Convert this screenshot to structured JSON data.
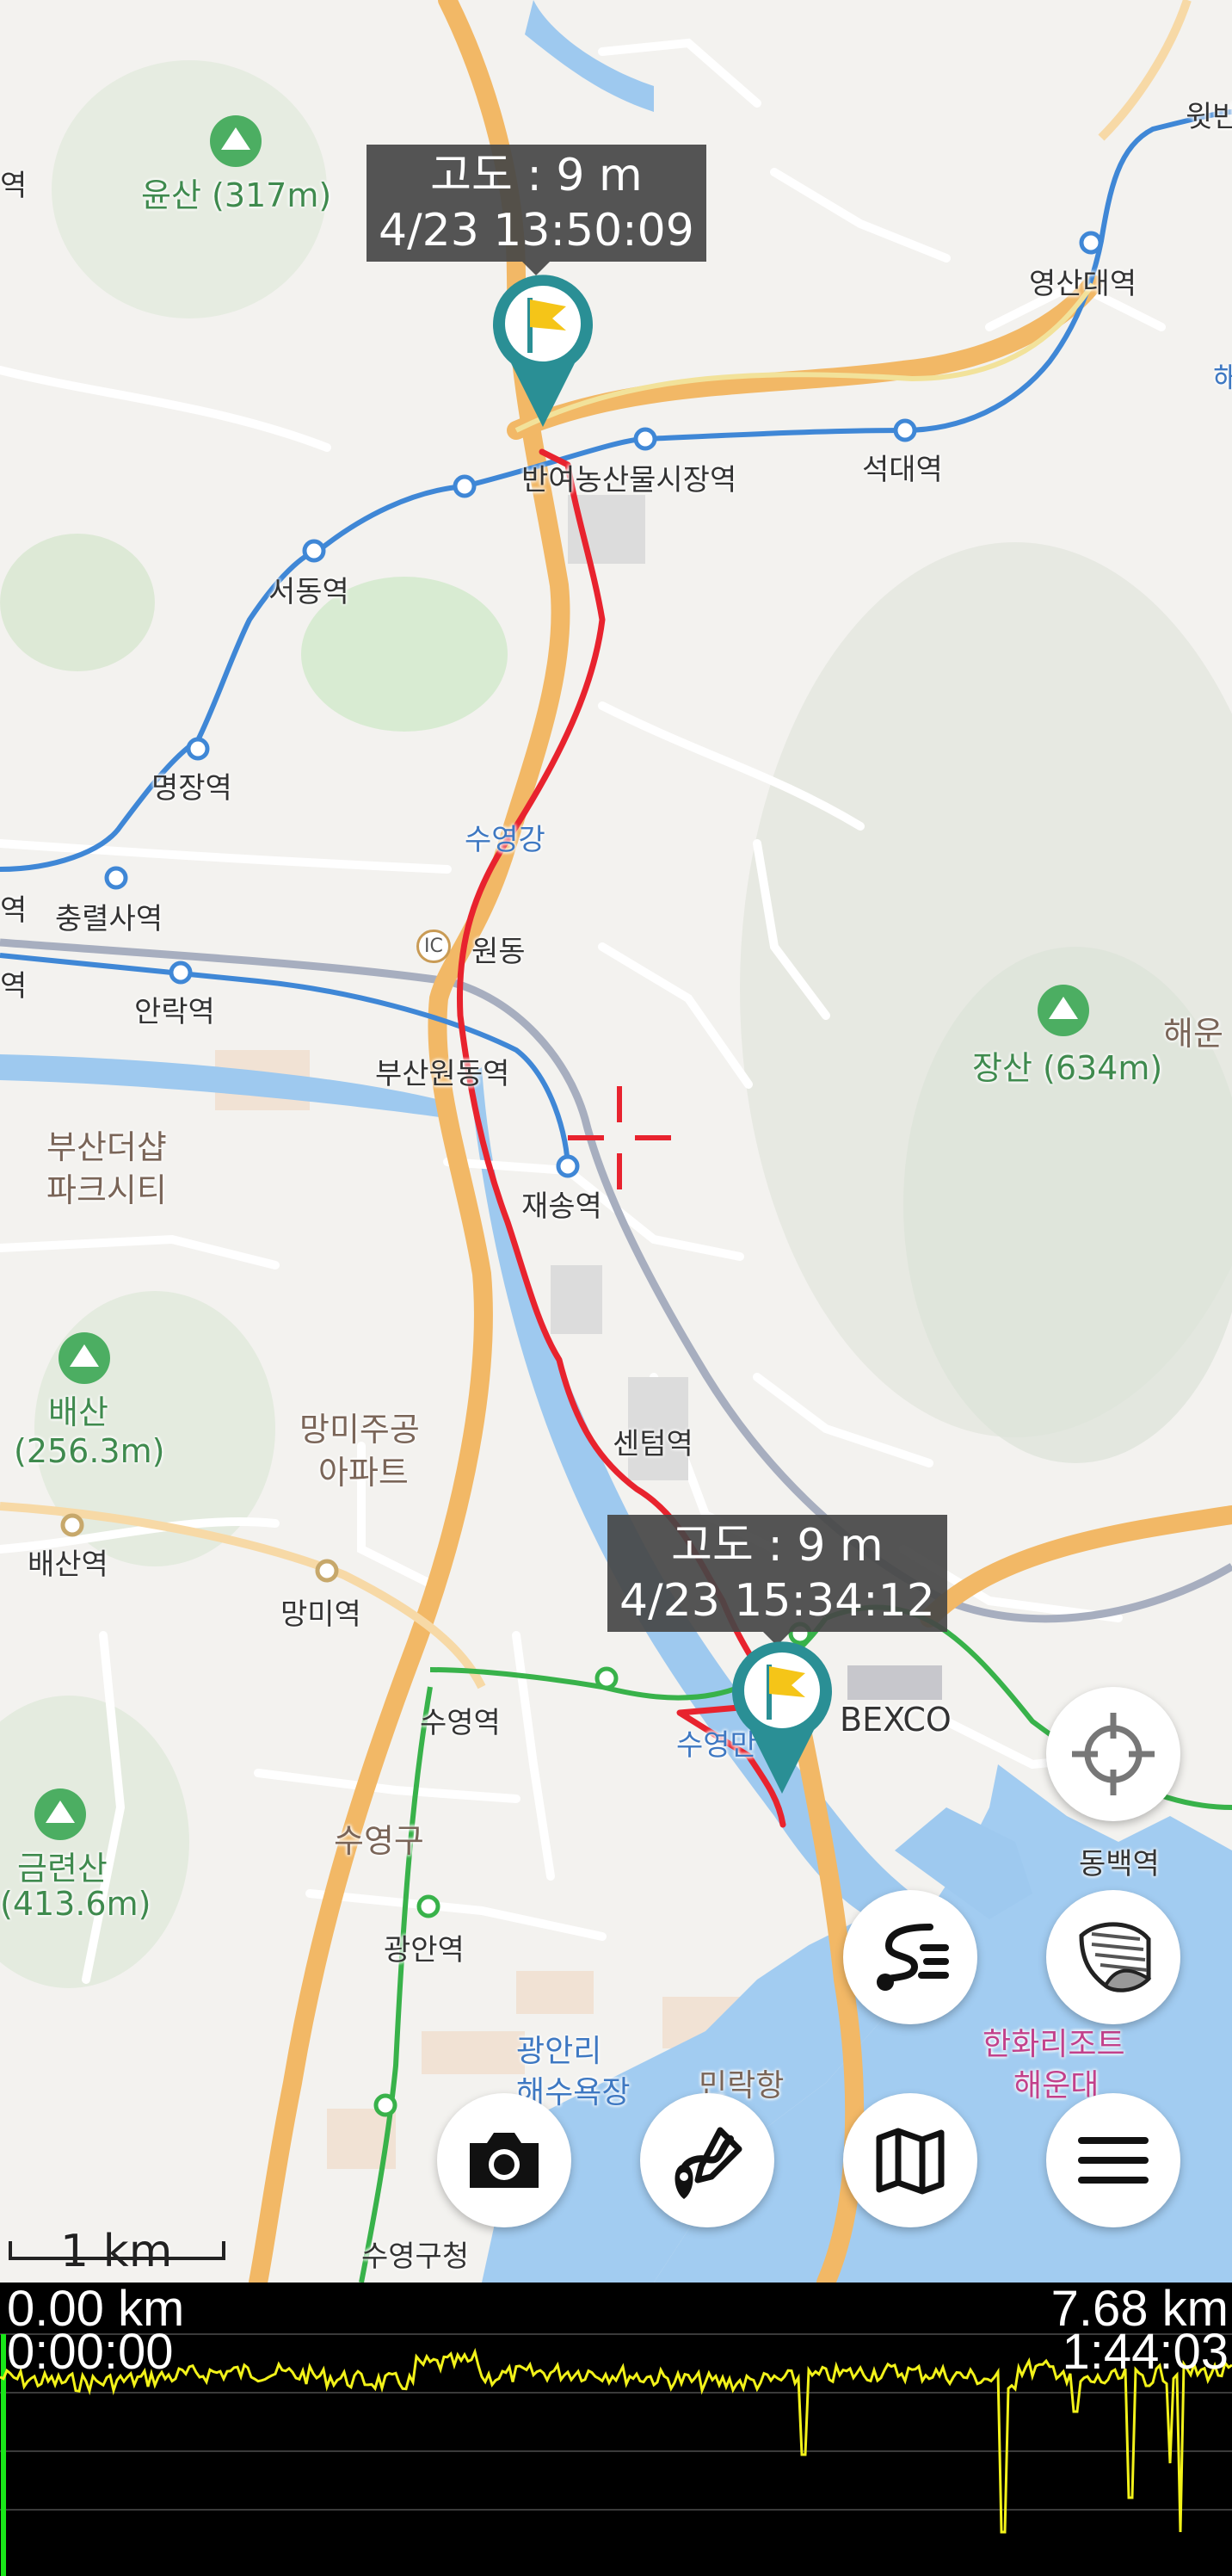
{
  "map": {
    "places": [
      {
        "id": "yunsan",
        "text": "윤산 (317m)"
      },
      {
        "id": "wit",
        "text": "윗반"
      },
      {
        "id": "yeongsan",
        "text": "영산대역"
      },
      {
        "id": "seokdae",
        "text": "석대역"
      },
      {
        "id": "banyeo",
        "text": "반여농산물시장역"
      },
      {
        "id": "seodong",
        "text": "서동역"
      },
      {
        "id": "myeongjang",
        "text": "명장역"
      },
      {
        "id": "suyeonggang",
        "text": "수영강"
      },
      {
        "id": "chungnyeolsa",
        "text": "충렬사역"
      },
      {
        "id": "wondong",
        "text": "원동"
      },
      {
        "id": "ic",
        "text": "IC"
      },
      {
        "id": "yeok_left1",
        "text": "역"
      },
      {
        "id": "yeok_left2",
        "text": "역"
      },
      {
        "id": "yeok_left3",
        "text": "역"
      },
      {
        "id": "allak",
        "text": "안락역"
      },
      {
        "id": "jangsan",
        "text": "장산 (634m)"
      },
      {
        "id": "haeun",
        "text": "해운"
      },
      {
        "id": "busanwondong",
        "text": "부산원동역"
      },
      {
        "id": "busanthesharp1",
        "text": "부산더샵"
      },
      {
        "id": "busanthesharp2",
        "text": "파크시티"
      },
      {
        "id": "jaesong",
        "text": "재송역"
      },
      {
        "id": "baesan1",
        "text": "배산"
      },
      {
        "id": "baesan2",
        "text": "(256.3m)"
      },
      {
        "id": "mangmi_apt1",
        "text": "망미주공"
      },
      {
        "id": "mangmi_apt2",
        "text": "아파트"
      },
      {
        "id": "centum",
        "text": "센텀역"
      },
      {
        "id": "baesanyeok",
        "text": "배산역"
      },
      {
        "id": "mangmi",
        "text": "망미역"
      },
      {
        "id": "bexco",
        "text": "BEXCO"
      },
      {
        "id": "suyeong",
        "text": "수영역"
      },
      {
        "id": "suyeong_partial",
        "text": "수영만"
      },
      {
        "id": "dongbaek",
        "text": "동백역"
      },
      {
        "id": "geumnyeon1",
        "text": "금련산"
      },
      {
        "id": "geumnyeon2",
        "text": "(413.6m)"
      },
      {
        "id": "suyeonggu",
        "text": "수영구"
      },
      {
        "id": "gwangan",
        "text": "광안역"
      },
      {
        "id": "gwangalli1",
        "text": "광안리"
      },
      {
        "id": "gwangalli2",
        "text": "해수욕장"
      },
      {
        "id": "millak",
        "text": "민락항"
      },
      {
        "id": "hanwha1",
        "text": "한화리조트"
      },
      {
        "id": "hanwha2",
        "text": "해운대"
      },
      {
        "id": "suyeonggucheong",
        "text": "수영구청"
      },
      {
        "id": "hae_right",
        "text": "해"
      }
    ],
    "start_marker": {
      "altitude": "고도 : 9 m",
      "time": "4/23 13:50:09"
    },
    "end_marker": {
      "altitude": "고도 : 9 m",
      "time": "4/23 15:34:12"
    },
    "scale_label": "1 km",
    "colors": {
      "track": "#e8232e",
      "pin": "#2a8f95",
      "flag": "#f5c518",
      "subway_blue": "#3f87d6",
      "subway_green": "#38b24a",
      "road_orange": "#f2b866",
      "water": "#9ec9ef"
    }
  },
  "buttons": [
    {
      "id": "locate",
      "icon": "crosshair-target-icon"
    },
    {
      "id": "layer",
      "icon": "layer-peel-icon"
    },
    {
      "id": "track_list",
      "icon": "track-list-icon"
    },
    {
      "id": "camera",
      "icon": "camera-icon"
    },
    {
      "id": "draw_route",
      "icon": "draw-route-icon"
    },
    {
      "id": "map",
      "icon": "folded-map-icon"
    },
    {
      "id": "menu",
      "icon": "hamburger-menu-icon"
    }
  ],
  "profile": {
    "start_distance": "0.00 km",
    "start_time": "0:00:00",
    "end_distance": "7.68 km",
    "end_time": "1:44:03",
    "colors": {
      "line": "#f2f21a",
      "grid": "#3a3a3a",
      "cursor": "#19e619"
    }
  }
}
